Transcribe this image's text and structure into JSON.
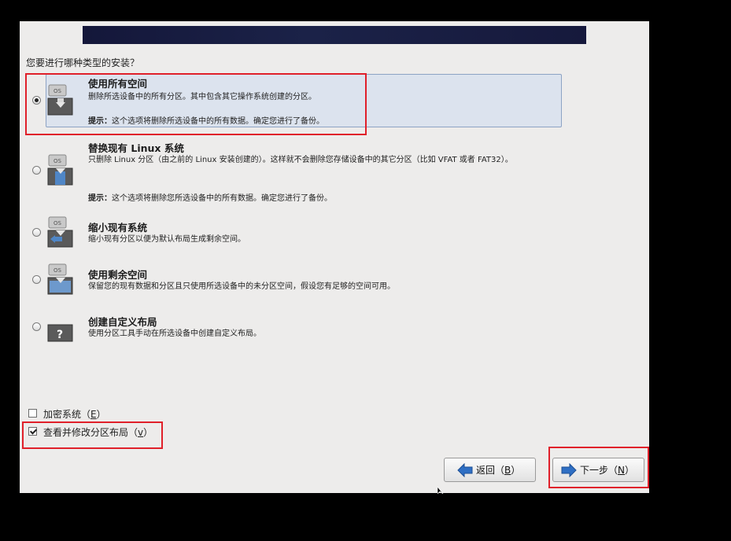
{
  "installer": {
    "question": "您要进行哪种类型的安装？",
    "options": [
      {
        "title": "使用所有空间",
        "description": "删除所选设备中的所有分区。其中包含其它操作系统创建的分区。",
        "hint_label": "提示：",
        "hint_text": "这个选项将删除所选设备中的所有数据。确定您进行了备份。",
        "selected": true,
        "icon": "os-replace-all-icon"
      },
      {
        "title": "替换现有 Linux 系统",
        "description": "只删除 Linux 分区（由之前的 Linux 安装创建的）。这样就不会删除您存储设备中的其它分区（比如 VFAT 或者 FAT32）。",
        "hint_label": "提示：",
        "hint_text": "这个选项将删除您所选设备中的所有数据。确定您进行了备份。",
        "selected": false,
        "icon": "os-replace-linux-icon"
      },
      {
        "title": "缩小现有系统",
        "description": "缩小现有分区以便为默认布局生成剩余空间。",
        "selected": false,
        "icon": "os-shrink-icon"
      },
      {
        "title": "使用剩余空间",
        "description": "保留您的现有数据和分区且只使用所选设备中的未分区空间，假设您有足够的空间可用。",
        "selected": false,
        "icon": "os-free-space-icon"
      },
      {
        "title": "创建自定义布局",
        "description": "使用分区工具手动在所选设备中创建自定义布局。",
        "selected": false,
        "icon": "custom-layout-question-icon"
      }
    ],
    "checkboxes": {
      "encrypt": {
        "label": "加密系统（",
        "mnemonic": "E",
        "suffix": "）",
        "checked": false
      },
      "review": {
        "label": "查看并修改分区布局（",
        "mnemonic": "v",
        "suffix": "）",
        "checked": true
      }
    },
    "buttons": {
      "back": {
        "label": "返回（",
        "mnemonic": "B",
        "suffix": "）"
      },
      "next": {
        "label": "下一步（",
        "mnemonic": "N",
        "suffix": "）"
      }
    },
    "colors": {
      "highlight": "#e0202a",
      "banner": "#1b2248",
      "arrow": "#2f6fc4"
    }
  }
}
